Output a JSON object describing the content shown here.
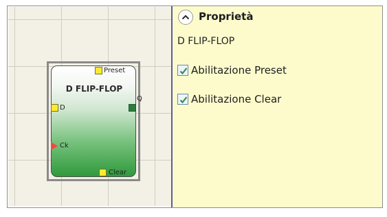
{
  "canvas": {
    "block": {
      "title": "D FLIP-FLOP",
      "pins": {
        "preset": "Preset",
        "d": "D",
        "q": "Q",
        "ck": "Ck",
        "clear": "Clear"
      }
    }
  },
  "properties": {
    "title": "Proprietà",
    "collapse_icon": "chevron-up-icon",
    "component_name": "D FLIP-FLOP",
    "options": [
      {
        "label": "Abilitazione Preset",
        "checked": true
      },
      {
        "label": "Abilitazione Clear",
        "checked": true
      }
    ]
  },
  "colors": {
    "panel_background": "#fdfbcc",
    "canvas_background": "#f3f1e6",
    "block_gradient_bottom": "#2f9a3c",
    "pin_input": "#ffeb2c",
    "pin_output": "#2b7e3d",
    "clock_pin": "#ef4b43",
    "checkmark": "#2f8f4e"
  }
}
